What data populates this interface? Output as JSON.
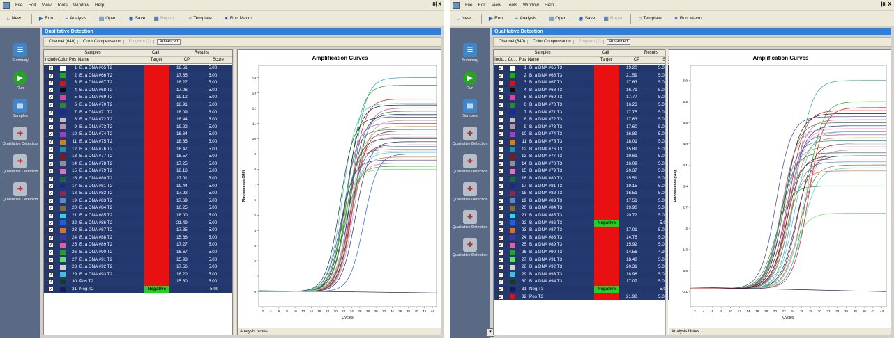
{
  "windows": [
    {
      "menu": [
        "File",
        "Edit",
        "View",
        "Tools",
        "Window",
        "Help"
      ],
      "window_controls": "_|8| X",
      "toolbar": [
        {
          "label": "New...",
          "icon": "new-icon",
          "enabled": true
        },
        {
          "label": "Run...",
          "icon": "run-icon",
          "enabled": true
        },
        {
          "label": "Analysis...",
          "icon": "analysis-icon",
          "enabled": true
        },
        {
          "label": "Open...",
          "icon": "open-icon",
          "enabled": true
        },
        {
          "label": "Save",
          "icon": "save-icon",
          "enabled": true
        },
        {
          "label": "Report",
          "icon": "report-icon",
          "enabled": false
        },
        {
          "label": "Template...",
          "icon": "template-icon",
          "enabled": true
        },
        {
          "label": "Run Macro",
          "icon": "macro-icon",
          "enabled": true
        }
      ],
      "title": "Qualitative Detection",
      "sidebar": [
        "Summary",
        "Run",
        "Samples",
        "Qualitative Detection",
        "Qualitative Detection",
        "Qualitative Detection"
      ],
      "subbar": {
        "channel": "Channel (640)",
        "color": "Color Compensation",
        "program": "Program (2)",
        "advanced": "Advanced"
      },
      "headers": {
        "samples": "Samples",
        "call": "Call",
        "results": "Results",
        "include": "Include",
        "color": "Color",
        "pos": "Pos",
        "name": "Name",
        "target": "Target",
        "cp": "CP",
        "score": "Score"
      },
      "rows": [
        {
          "pos": "1",
          "name": "B. a DNA #65 T2",
          "call": "Positive",
          "cp": "18.51",
          "score": "5.00",
          "color": "#ffffff"
        },
        {
          "pos": "2",
          "name": "B. a DNA #66 T2",
          "call": "Positive",
          "cp": "17.65",
          "score": "5.00",
          "color": "#1eaa1e"
        },
        {
          "pos": "3",
          "name": "B. a DNA #67 T2",
          "call": "Positive",
          "cp": "18.27",
          "score": "5.00",
          "color": "#e01010"
        },
        {
          "pos": "4",
          "name": "B. a DNA #68 T2",
          "call": "Positive",
          "cp": "17.06",
          "score": "5.00",
          "color": "#101010"
        },
        {
          "pos": "5",
          "name": "B. a DNA #69 T2",
          "call": "Positive",
          "cp": "19.12",
          "score": "5.00",
          "color": "#e040a0"
        },
        {
          "pos": "6",
          "name": "B. a DNA #70 T2",
          "call": "Positive",
          "cp": "18.91",
          "score": "5.00",
          "color": "#2a8a2a"
        },
        {
          "pos": "7",
          "name": "B. a DNA #71 T2",
          "call": "Positive",
          "cp": "18.09",
          "score": "5.00",
          "color": "#1a2a9a"
        },
        {
          "pos": "8",
          "name": "B. a DNA #72 T2",
          "call": "Positive",
          "cp": "18.44",
          "score": "5.00",
          "color": "#c0c0c0"
        },
        {
          "pos": "9",
          "name": "B. a DNA #73 T2",
          "call": "Positive",
          "cp": "19.22",
          "score": "5.00",
          "color": "#c090a0"
        },
        {
          "pos": "10",
          "name": "B. a DNA #74 T2",
          "call": "Positive",
          "cp": "16.64",
          "score": "5.00",
          "color": "#a040c0"
        },
        {
          "pos": "11",
          "name": "B. a DNA #75 T2",
          "call": "Positive",
          "cp": "18.65",
          "score": "5.00",
          "color": "#d08020"
        },
        {
          "pos": "12",
          "name": "B. a DNA #76 T2",
          "call": "Positive",
          "cp": "16.47",
          "score": "5.00",
          "color": "#2090a0"
        },
        {
          "pos": "13",
          "name": "B. a DNA #77 T2",
          "call": "Positive",
          "cp": "18.57",
          "score": "5.00",
          "color": "#7a1a1a"
        },
        {
          "pos": "14",
          "name": "B. a DNA #78 T2",
          "call": "Positive",
          "cp": "17.25",
          "score": "5.00",
          "color": "#909090"
        },
        {
          "pos": "15",
          "name": "B. a DNA #79 T2",
          "call": "Positive",
          "cp": "18.16",
          "score": "5.00",
          "color": "#e070c0"
        },
        {
          "pos": "16",
          "name": "B. a DNA #80 T2",
          "call": "Positive",
          "cp": "17.01",
          "score": "5.00",
          "color": "#1a6a3a"
        },
        {
          "pos": "17",
          "name": "B. a DNA #81 T2",
          "call": "Positive",
          "cp": "19.44",
          "score": "5.00",
          "color": "#202a7a"
        },
        {
          "pos": "18",
          "name": "B. a DNA #82 T2",
          "call": "Positive",
          "cp": "17.92",
          "score": "5.00",
          "color": "#8a2a4a"
        },
        {
          "pos": "19",
          "name": "B. a DNA #83 T2",
          "call": "Positive",
          "cp": "17.69",
          "score": "5.00",
          "color": "#5a8ac0"
        },
        {
          "pos": "20",
          "name": "B. a DNA #84 T2",
          "call": "Positive",
          "cp": "16.25",
          "score": "5.00",
          "color": "#8a6a2a"
        },
        {
          "pos": "21",
          "name": "B. a DNA #85 T2",
          "call": "Positive",
          "cp": "18.00",
          "score": "5.00",
          "color": "#30d0f0"
        },
        {
          "pos": "22",
          "name": "B. a DNA #86 T2",
          "call": "Positive",
          "cp": "21.49",
          "score": "5.00",
          "color": "#2060e0"
        },
        {
          "pos": "23",
          "name": "B. a DNA #87 T2",
          "call": "Positive",
          "cp": "17.85",
          "score": "5.00",
          "color": "#e07020"
        },
        {
          "pos": "24",
          "name": "B. a DNA #88 T2",
          "call": "Positive",
          "cp": "15.66",
          "score": "5.00",
          "color": "#3a3a9a"
        },
        {
          "pos": "25",
          "name": "B. a DNA #89 T2",
          "call": "Positive",
          "cp": "17.27",
          "score": "5.00",
          "color": "#e060a0"
        },
        {
          "pos": "26",
          "name": "B. a DNA #90 T2",
          "call": "Positive",
          "cp": "16.67",
          "score": "5.00",
          "color": "#2aa02a"
        },
        {
          "pos": "27",
          "name": "B. a DNA #91 T2",
          "call": "Positive",
          "cp": "15.93",
          "score": "5.00",
          "color": "#60e060"
        },
        {
          "pos": "28",
          "name": "B. a DNA #92 T2",
          "call": "Positive",
          "cp": "17.56",
          "score": "5.00",
          "color": "#d0d0d0"
        },
        {
          "pos": "29",
          "name": "B. a DNA #93 T2",
          "call": "Positive",
          "cp": "16.20",
          "score": "5.00",
          "color": "#40c0e0"
        },
        {
          "pos": "30",
          "name": "Pos T2",
          "call": "Positive",
          "cp": "15.60",
          "score": "5.00",
          "color": "#1a3a1a"
        },
        {
          "pos": "31",
          "name": "Neg T2",
          "call": "Negative",
          "cp": "",
          "score": "-5.00",
          "color": "#1a1a5a"
        }
      ],
      "chart_data": {
        "type": "line",
        "title": "Amplification Curves",
        "xlabel": "Cycles",
        "ylabel": "Fluorescence (640)",
        "x_ticks": [
          "2",
          "4",
          "6",
          "8",
          "10",
          "12",
          "14",
          "16",
          "18",
          "20",
          "22",
          "24",
          "26",
          "28",
          "30",
          "32",
          "34",
          "36",
          "38",
          "40",
          "42",
          "44"
        ],
        "y_ticks": [
          "0",
          "1",
          "2",
          "3",
          "4",
          "5",
          "6",
          "7",
          "8",
          "9",
          "10",
          "11",
          "12",
          "13",
          "14"
        ],
        "xlim": [
          1,
          45
        ],
        "ylim": [
          -1,
          14.8
        ],
        "baseline": 0,
        "series_plateaus": [
          14.0,
          13.5,
          12.6,
          12.2,
          12.0,
          11.8,
          11.6,
          11.5,
          11.2,
          11.0,
          10.8,
          10.6,
          10.5,
          10.3,
          10.1,
          10.0,
          9.8,
          9.6,
          9.5,
          9.3,
          9.1,
          9.0,
          8.8,
          8.6,
          8.4,
          8.2,
          8.0,
          9.2,
          12.3,
          11.4
        ],
        "series_cp": [
          18.51,
          17.65,
          18.27,
          17.06,
          19.12,
          18.91,
          18.09,
          18.44,
          19.22,
          16.64,
          18.65,
          16.47,
          18.57,
          17.25,
          18.16,
          17.01,
          19.44,
          17.92,
          17.69,
          16.25,
          18.0,
          21.49,
          17.85,
          15.66,
          17.27,
          16.67,
          15.93,
          17.56,
          16.2,
          15.6
        ],
        "notes_label": "Analysis Notes"
      }
    },
    {
      "menu": [
        "File",
        "Edit",
        "View",
        "Tools",
        "Window",
        "Help"
      ],
      "window_controls": "_|8| X",
      "toolbar": [
        {
          "label": "New...",
          "icon": "new-icon",
          "enabled": true
        },
        {
          "label": "Run...",
          "icon": "run-icon",
          "enabled": true
        },
        {
          "label": "Analysis...",
          "icon": "analysis-icon",
          "enabled": true
        },
        {
          "label": "Open...",
          "icon": "open-icon",
          "enabled": true
        },
        {
          "label": "Save",
          "icon": "save-icon",
          "enabled": true
        },
        {
          "label": "Report",
          "icon": "report-icon",
          "enabled": false
        },
        {
          "label": "Template...",
          "icon": "template-icon",
          "enabled": true
        },
        {
          "label": "Run Macro",
          "icon": "macro-icon",
          "enabled": true
        }
      ],
      "title": "Qualitative Detection",
      "sidebar": [
        "Summary",
        "Run",
        "Samples",
        "Qualitative Detection",
        "Qualitative Detection",
        "Qualitative Detection",
        "Qualitative Detection",
        "Qualitative Detection"
      ],
      "subbar": {
        "channel": "Channel (640)",
        "color": "Color Compensation",
        "program": "Program (2)",
        "advanced": "Advanced"
      },
      "headers": {
        "samples": "Samples",
        "call": "Call",
        "results": "Results",
        "include": "Inclu...",
        "color": "Co...",
        "pos": "Pos",
        "name": "Name",
        "target": "Target",
        "cp": "CP",
        "score": "Score"
      },
      "rows": [
        {
          "pos": "1",
          "name": "B. a DNA #65 T3",
          "call": "Positive",
          "cp": "19.20",
          "score": "5.00",
          "color": "#ffffff"
        },
        {
          "pos": "2",
          "name": "B. a DNA #66 T3",
          "call": "Positive",
          "cp": "21.59",
          "score": "5.00",
          "color": "#1eaa1e"
        },
        {
          "pos": "3",
          "name": "B. a DNA #67 T3",
          "call": "Positive",
          "cp": "17.63",
          "score": "5.00",
          "color": "#e01010"
        },
        {
          "pos": "4",
          "name": "B. a DNA #68 T3",
          "call": "Positive",
          "cp": "16.71",
          "score": "5.00",
          "color": "#101010"
        },
        {
          "pos": "5",
          "name": "B. a DNA #69 T3",
          "call": "Positive",
          "cp": "17.77",
          "score": "5.00",
          "color": "#e040a0"
        },
        {
          "pos": "6",
          "name": "B. a DNA #70 T3",
          "call": "Positive",
          "cp": "16.23",
          "score": "5.00",
          "color": "#2a8a2a"
        },
        {
          "pos": "7",
          "name": "B. a DNA #71 T3",
          "call": "Positive",
          "cp": "17.75",
          "score": "5.00",
          "color": "#1a2a9a"
        },
        {
          "pos": "8",
          "name": "B. a DNA #72 T3",
          "call": "Positive",
          "cp": "17.63",
          "score": "5.00",
          "color": "#c0c0c0"
        },
        {
          "pos": "9",
          "name": "B. a DNA #73 T3",
          "call": "Positive",
          "cp": "17.60",
          "score": "5.00",
          "color": "#c090a0"
        },
        {
          "pos": "10",
          "name": "B. a DNA #74 T3",
          "call": "Positive",
          "cp": "16.89",
          "score": "5.00",
          "color": "#a040c0"
        },
        {
          "pos": "11",
          "name": "B. a DNA #75 T3",
          "call": "Positive",
          "cp": "18.01",
          "score": "5.00",
          "color": "#d08020"
        },
        {
          "pos": "12",
          "name": "B. a DNA #76 T3",
          "call": "Positive",
          "cp": "15.89",
          "score": "5.00",
          "color": "#2090a0"
        },
        {
          "pos": "13",
          "name": "B. a DNA #77 T3",
          "call": "Positive",
          "cp": "19.61",
          "score": "5.00",
          "color": "#7a1a1a"
        },
        {
          "pos": "14",
          "name": "B. a DNA #78 T3",
          "call": "Positive",
          "cp": "16.09",
          "score": "5.00",
          "color": "#909090"
        },
        {
          "pos": "15",
          "name": "B. a DNA #79 T3",
          "call": "Positive",
          "cp": "20.37",
          "score": "5.00",
          "color": "#e070c0"
        },
        {
          "pos": "16",
          "name": "B. a DNA #80 T3",
          "call": "Positive",
          "cp": "15.51",
          "score": "5.00",
          "color": "#1a6a3a"
        },
        {
          "pos": "17",
          "name": "B. a DNA #81 T3",
          "call": "Positive",
          "cp": "19.15",
          "score": "5.00",
          "color": "#202a7a"
        },
        {
          "pos": "18",
          "name": "B. a DNA #82 T3",
          "call": "Positive",
          "cp": "16.51",
          "score": "5.00",
          "color": "#8a2a4a"
        },
        {
          "pos": "19",
          "name": "B. a DNA #83 T3",
          "call": "Positive",
          "cp": "17.51",
          "score": "5.00",
          "color": "#5a8ac0"
        },
        {
          "pos": "20",
          "name": "B. a DNA #84 T3",
          "call": "Positive",
          "cp": "19.90",
          "score": "5.00",
          "color": "#8a6a2a"
        },
        {
          "pos": "21",
          "name": "B. a DNA #85 T3",
          "call": "Positive",
          "cp": "20.72",
          "score": "5.00",
          "color": "#30d0f0"
        },
        {
          "pos": "22",
          "name": "B. a DNA #86 T3",
          "call": "Negative",
          "cp": "",
          "score": "-5.00",
          "color": "#2060e0"
        },
        {
          "pos": "23",
          "name": "B. a DNA #87 T3",
          "call": "Positive",
          "cp": "17.01",
          "score": "5.00",
          "color": "#e07020"
        },
        {
          "pos": "24",
          "name": "B. a DNA #88 T3",
          "call": "Positive",
          "cp": "14.75",
          "score": "5.00",
          "color": "#3a3a9a"
        },
        {
          "pos": "25",
          "name": "B. a DNA #89 T3",
          "call": "Positive",
          "cp": "15.92",
          "score": "5.00",
          "color": "#e060a0"
        },
        {
          "pos": "26",
          "name": "B. a DNA #90 T3",
          "call": "Positive",
          "cp": "14.56",
          "score": "4.99",
          "color": "#2aa02a"
        },
        {
          "pos": "27",
          "name": "B. a DNA #91 T3",
          "call": "Positive",
          "cp": "18.40",
          "score": "5.00",
          "color": "#60e060"
        },
        {
          "pos": "28",
          "name": "B. a DNA #92 T3",
          "call": "Positive",
          "cp": "20.31",
          "score": "5.00",
          "color": "#d0d0d0"
        },
        {
          "pos": "29",
          "name": "B. a DNA #93 T3",
          "call": "Positive",
          "cp": "18.96",
          "score": "5.00",
          "color": "#40c0e0"
        },
        {
          "pos": "30",
          "name": "B. a DNA #94 T3",
          "call": "Positive",
          "cp": "17.07",
          "score": "5.00",
          "color": "#1a3a1a"
        },
        {
          "pos": "31",
          "name": "Neg T3",
          "call": "Negative",
          "cp": "",
          "score": "-5.00",
          "color": "#1a1a5a"
        },
        {
          "pos": "32",
          "name": "Pos T3",
          "call": "Positive",
          "cp": "21.98",
          "score": "5.00",
          "color": "#e01010"
        }
      ],
      "chart_data": {
        "type": "line",
        "title": "Amplification Curves",
        "xlabel": "Cycles",
        "ylabel": "Fluorescence (640)",
        "x_ticks": [
          "2",
          "4",
          "6",
          "8",
          "10",
          "12",
          "14",
          "16",
          "18",
          "20",
          "22",
          "24",
          "26",
          "28",
          "30",
          "32",
          "34",
          "36",
          "38",
          "40",
          "42",
          "44"
        ],
        "y_ticks": [
          "-0.1",
          "0.6",
          "1.3",
          "2",
          "2.7",
          "3.4",
          "4.1",
          "4.8",
          "5.5",
          "6.2",
          "6.9"
        ],
        "xlim": [
          1,
          45
        ],
        "ylim": [
          -0.6,
          7.4
        ],
        "baseline": 0,
        "series_plateaus": [
          6.9,
          6.2,
          5.9,
          5.8,
          5.6,
          5.5,
          5.4,
          5.3,
          5.2,
          5.1,
          5.0,
          4.9,
          4.8,
          4.7,
          4.6,
          4.5,
          4.4,
          4.3,
          4.2,
          4.1,
          4.0,
          3.9,
          5.7,
          5.3,
          3.4,
          2.5,
          4.8,
          5.2,
          4.4,
          6.0
        ],
        "series_cp": [
          19.2,
          21.59,
          17.63,
          16.71,
          17.77,
          16.23,
          17.75,
          17.63,
          17.6,
          16.89,
          18.01,
          15.89,
          19.61,
          16.09,
          20.37,
          15.51,
          19.15,
          16.51,
          17.51,
          19.9,
          20.72,
          17.01,
          14.75,
          15.92,
          14.56,
          18.4,
          20.31,
          18.96,
          17.07,
          21.98
        ],
        "notes_label": "Analysis Notes"
      }
    }
  ]
}
